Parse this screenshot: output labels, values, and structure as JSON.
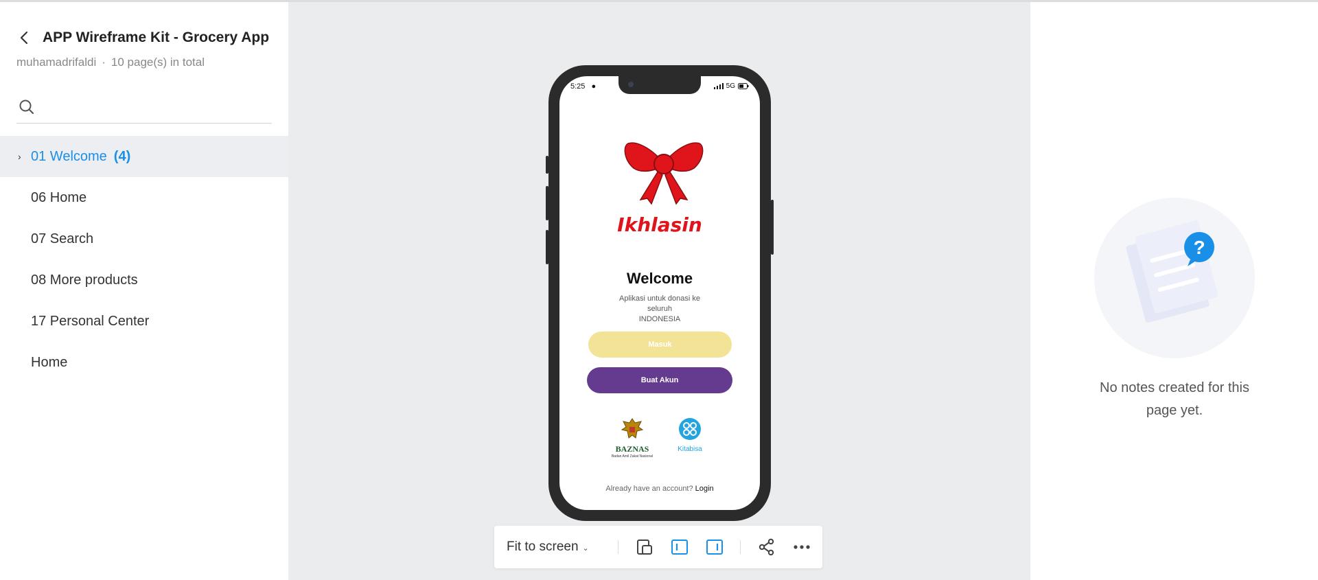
{
  "sidebar": {
    "project_title": "APP Wireframe Kit - Grocery App",
    "author": "muhamadrifaldi",
    "separator": "·",
    "page_count_text": "10 page(s) in total",
    "search_placeholder": "",
    "pages": [
      {
        "label": "01 Welcome",
        "count": "(4)",
        "active": true
      },
      {
        "label": "06 Home"
      },
      {
        "label": "07 Search"
      },
      {
        "label": "08 More products"
      },
      {
        "label": "17 Personal Center"
      },
      {
        "label": "Home"
      }
    ]
  },
  "phone_screen": {
    "status_time": "5:25",
    "status_network": "5G",
    "brand_name": "Ikhlasin",
    "welcome_title": "Welcome",
    "subtitle_line1": "Aplikasi untuk donasi ke",
    "subtitle_line2": "seluruh",
    "subtitle_line3": "INDONESIA",
    "login_button": "Masuk",
    "register_button": "Buat Akun",
    "partner1_name": "BAZNAS",
    "partner1_sub": "Badan Amil Zakat Nasional",
    "partner2_name": "Kitabisa",
    "footer_text": "Already have an account?",
    "footer_link": "Login"
  },
  "toolbar": {
    "zoom_label": "Fit to screen",
    "icons": [
      "copy-frame-icon",
      "single-page-icon",
      "split-view-icon",
      "share-icon",
      "more-icon"
    ]
  },
  "notes_panel": {
    "empty_message": "No notes created for this page yet."
  },
  "colors": {
    "accent": "#1a8fe8",
    "canvas_bg": "#ebecee",
    "brand_red": "#e0151c",
    "masuk_button": "#f2e396",
    "buat_akun_button": "#643b8e"
  }
}
